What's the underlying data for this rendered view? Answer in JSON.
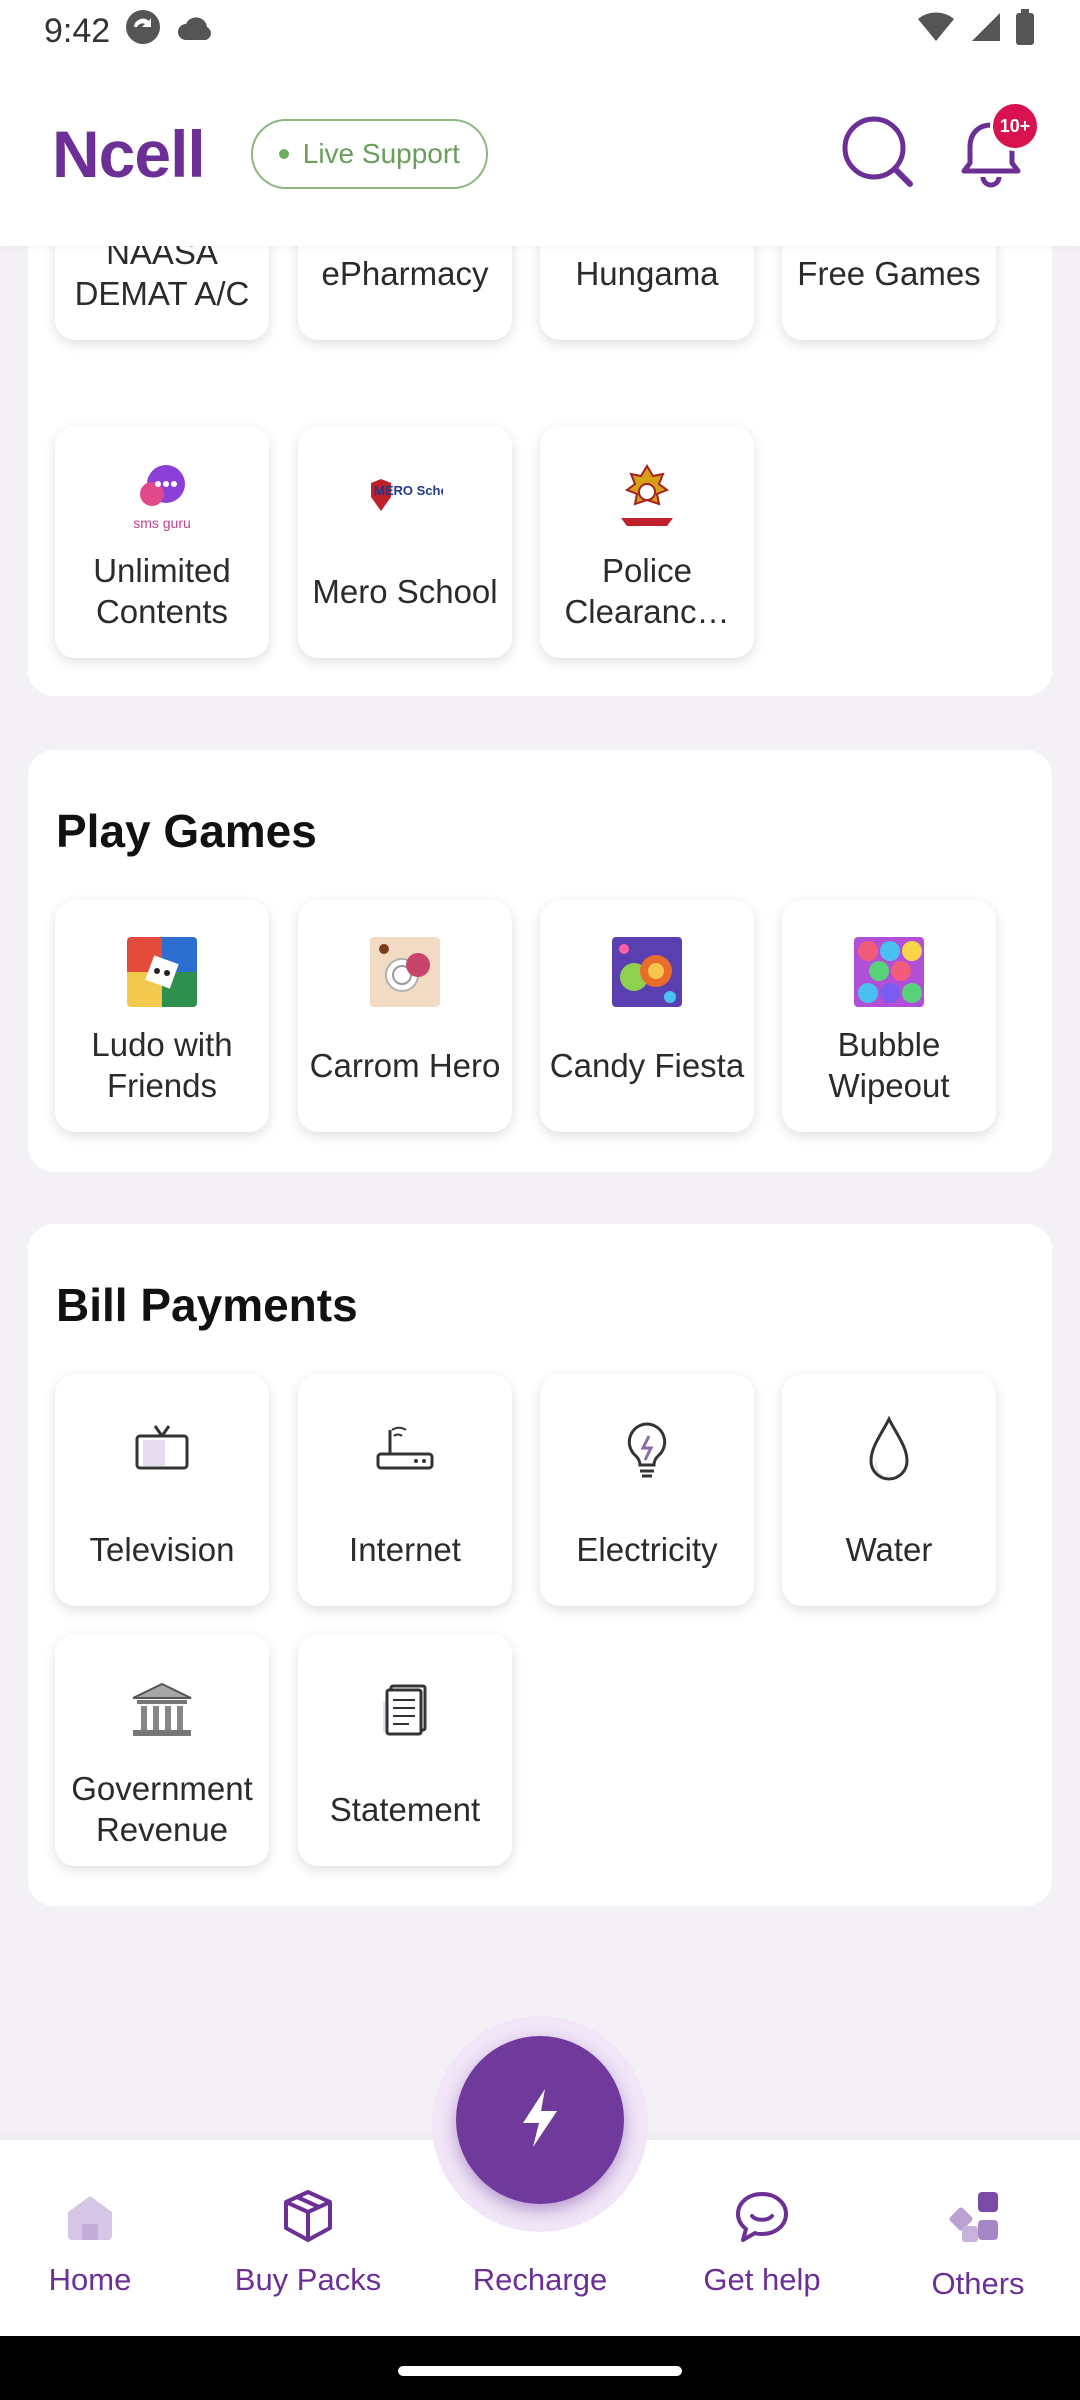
{
  "status_bar": {
    "time": "9:42"
  },
  "header": {
    "logo": "Ncell",
    "live_support": "Live Support",
    "notification_badge": "10+",
    "brand_color": "#6b2f96"
  },
  "top_services": {
    "row1": [
      "NAASA DEMAT A/C",
      "ePharmacy",
      "Hungama",
      "Free Games"
    ],
    "row2": [
      "Unlimited Contents",
      "Mero School",
      "Police Clearanc…"
    ],
    "icon_texts": {
      "sms_guru": "sms guru",
      "mero_school": "MERO School"
    }
  },
  "play_games": {
    "title": "Play Games",
    "items": [
      "Ludo with Friends",
      "Carrom Hero",
      "Candy Fiesta",
      "Bubble Wipeout"
    ]
  },
  "bill_payments": {
    "title": "Bill Payments",
    "items": [
      "Television",
      "Internet",
      "Electricity",
      "Water",
      "Government Revenue",
      "Statement"
    ]
  },
  "bottom_nav": {
    "home": "Home",
    "buy_packs": "Buy Packs",
    "recharge": "Recharge",
    "get_help": "Get help",
    "others": "Others"
  }
}
